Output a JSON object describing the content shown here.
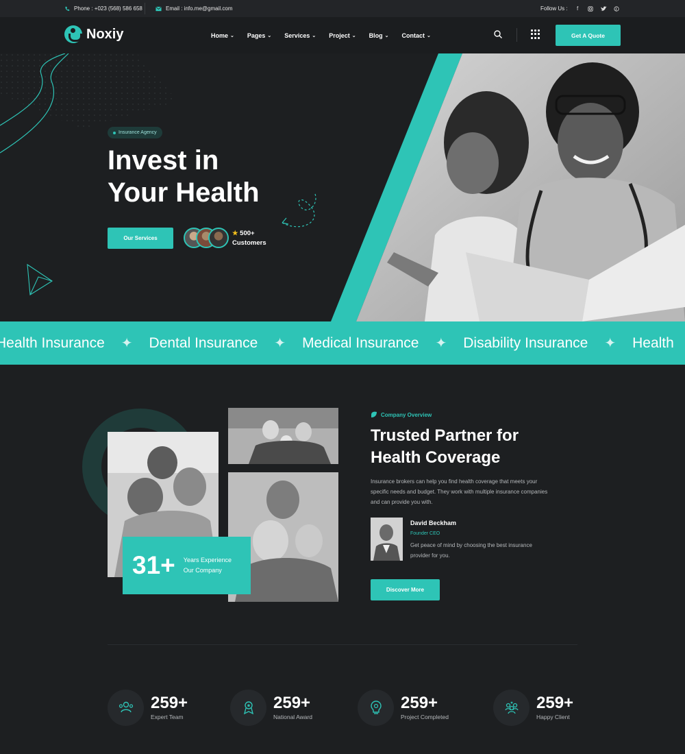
{
  "topbar": {
    "phone": "Phone : +023 (568) 586 658",
    "email": "Email : info.me@gmail.com",
    "follow_label": "Follow Us :",
    "social": [
      "facebook-icon",
      "instagram-icon",
      "twitter-icon",
      "pinterest-icon"
    ]
  },
  "nav": {
    "brand": "Noxiy",
    "menu": [
      {
        "label": "Home"
      },
      {
        "label": "Pages"
      },
      {
        "label": "Services"
      },
      {
        "label": "Project"
      },
      {
        "label": "Blog"
      },
      {
        "label": "Contact"
      }
    ],
    "cta": "Get A Quote"
  },
  "hero": {
    "badge": "Insurance Agency",
    "title_line1": "Invest in",
    "title_line2": "Your Health",
    "button": "Our Services",
    "customers_count": "500+",
    "customers_label": "Customers"
  },
  "marquee": {
    "items": [
      "Health Insurance",
      "Dental Insurance",
      "Medical Insurance",
      "Disability Insurance",
      "Health"
    ]
  },
  "about": {
    "experience_number": "31+",
    "experience_line1": "Years Experience",
    "experience_line2": "Our Company",
    "tag": "Company Overview",
    "title_line1": "Trusted Partner for",
    "title_line2": "Health Coverage",
    "description": "Insurance brokers can help you find health coverage that meets your specific needs and budget. They work with multiple insurance companies and can provide you with.",
    "ceo_name": "David Beckham",
    "ceo_role": "Founder CEO",
    "ceo_quote": "Get peace of mind by choosing the best insurance provider for you.",
    "button": "Discover More"
  },
  "stats": [
    {
      "number": "259+",
      "label": "Expert Team",
      "icon": "team-icon"
    },
    {
      "number": "259+",
      "label": "National Award",
      "icon": "award-icon"
    },
    {
      "number": "259+",
      "label": "Project Completed",
      "icon": "project-icon"
    },
    {
      "number": "259+",
      "label": "Happy Client",
      "icon": "client-icon"
    }
  ],
  "colors": {
    "accent": "#2ec4b6",
    "background": "#1d1f21",
    "topbar": "#232528"
  }
}
